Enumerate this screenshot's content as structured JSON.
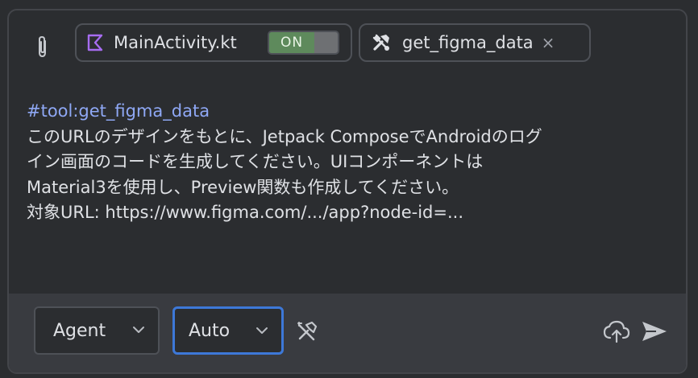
{
  "chips": {
    "file": {
      "label": "MainActivity.kt",
      "toggle": "ON"
    },
    "tool": {
      "label": "get_figma_data",
      "close": "×"
    }
  },
  "prompt": {
    "tool_ref": "#tool:get_figma_data",
    "lines": [
      "このURLのデザインをもとに、Jetpack ComposeでAndroidのログ",
      "イン画面のコードを生成してください。UIコンポーネントは",
      "Material3を使用し、Preview関数も作成してください。",
      "対象URL:  https://www.figma.com/.../app?node-id=..."
    ]
  },
  "toolbar": {
    "mode": "Agent",
    "model": "Auto"
  },
  "icons": {
    "attach": "paperclip-icon",
    "kotlin": "kotlin-file-icon",
    "tool": "tools-icon",
    "tools_button": "tools-icon",
    "cloud": "cloud-upload-icon",
    "send": "send-icon"
  },
  "colors": {
    "background": "#2b2d30",
    "bottom_bar": "#393b40",
    "border": "#4e5157",
    "text": "#dfe1e5",
    "tool_ref": "#8fa8f5",
    "toggle_on": "#5e8a5c",
    "focus": "#3d78d8",
    "kotlin_accent": "#a66cf0"
  }
}
